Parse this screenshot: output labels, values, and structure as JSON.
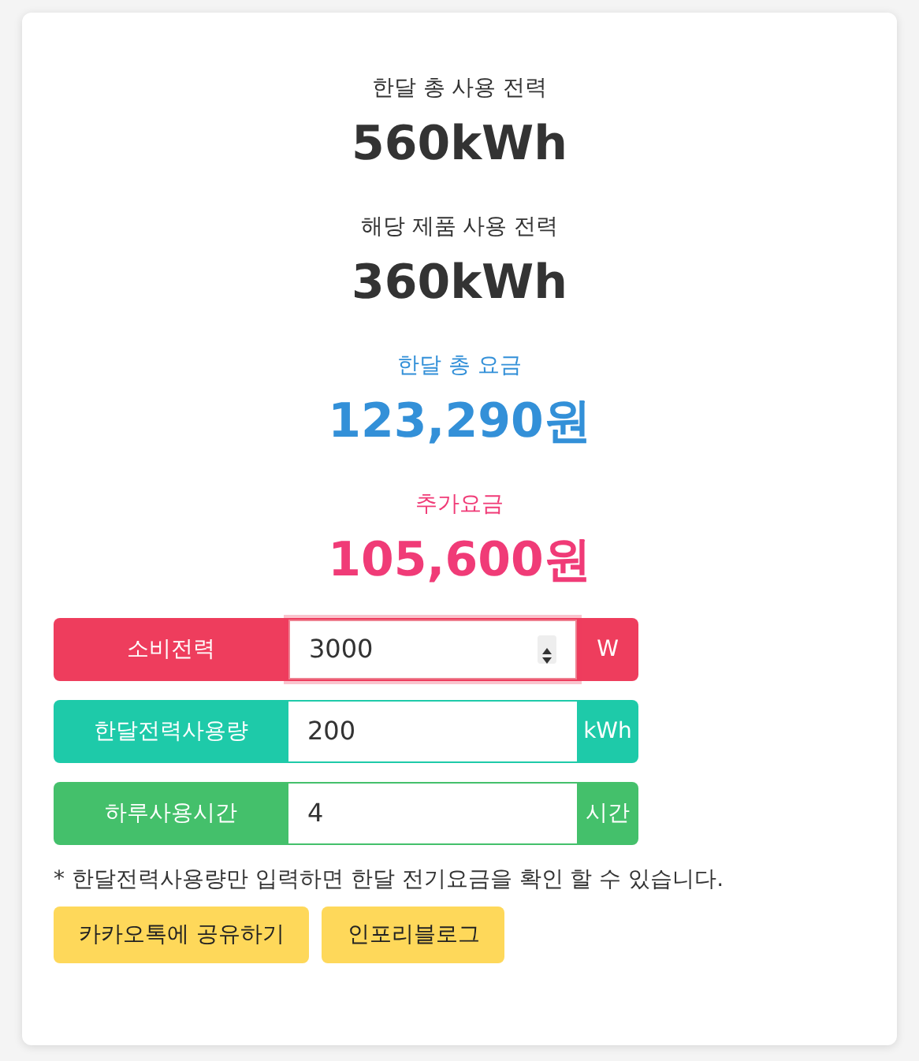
{
  "stats": [
    {
      "label": "한달 총 사용 전력",
      "value": "560kWh",
      "kind": "plain"
    },
    {
      "label": "해당 제품 사용 전력",
      "value": "360kWh",
      "kind": "plain"
    },
    {
      "label": "한달 총 요금",
      "value": "123,290원",
      "kind": "fee"
    },
    {
      "label": "추가요금",
      "value": "105,600원",
      "kind": "extra"
    }
  ],
  "fields": [
    {
      "label": "소비전력",
      "value": "3000",
      "unit": "W",
      "color": "#ee3d5d",
      "focused": true
    },
    {
      "label": "한달전력사용량",
      "value": "200",
      "unit": "kWh",
      "color": "#1ecaa9",
      "focused": false
    },
    {
      "label": "하루사용시간",
      "value": "4",
      "unit": "시간",
      "color": "#44c06b",
      "focused": false
    }
  ],
  "note": "* 한달전력사용량만 입력하면 한달 전기요금을 확인 할 수 있습니다.",
  "buttons": [
    "카카오톡에 공유하기",
    "인포리블로그"
  ]
}
